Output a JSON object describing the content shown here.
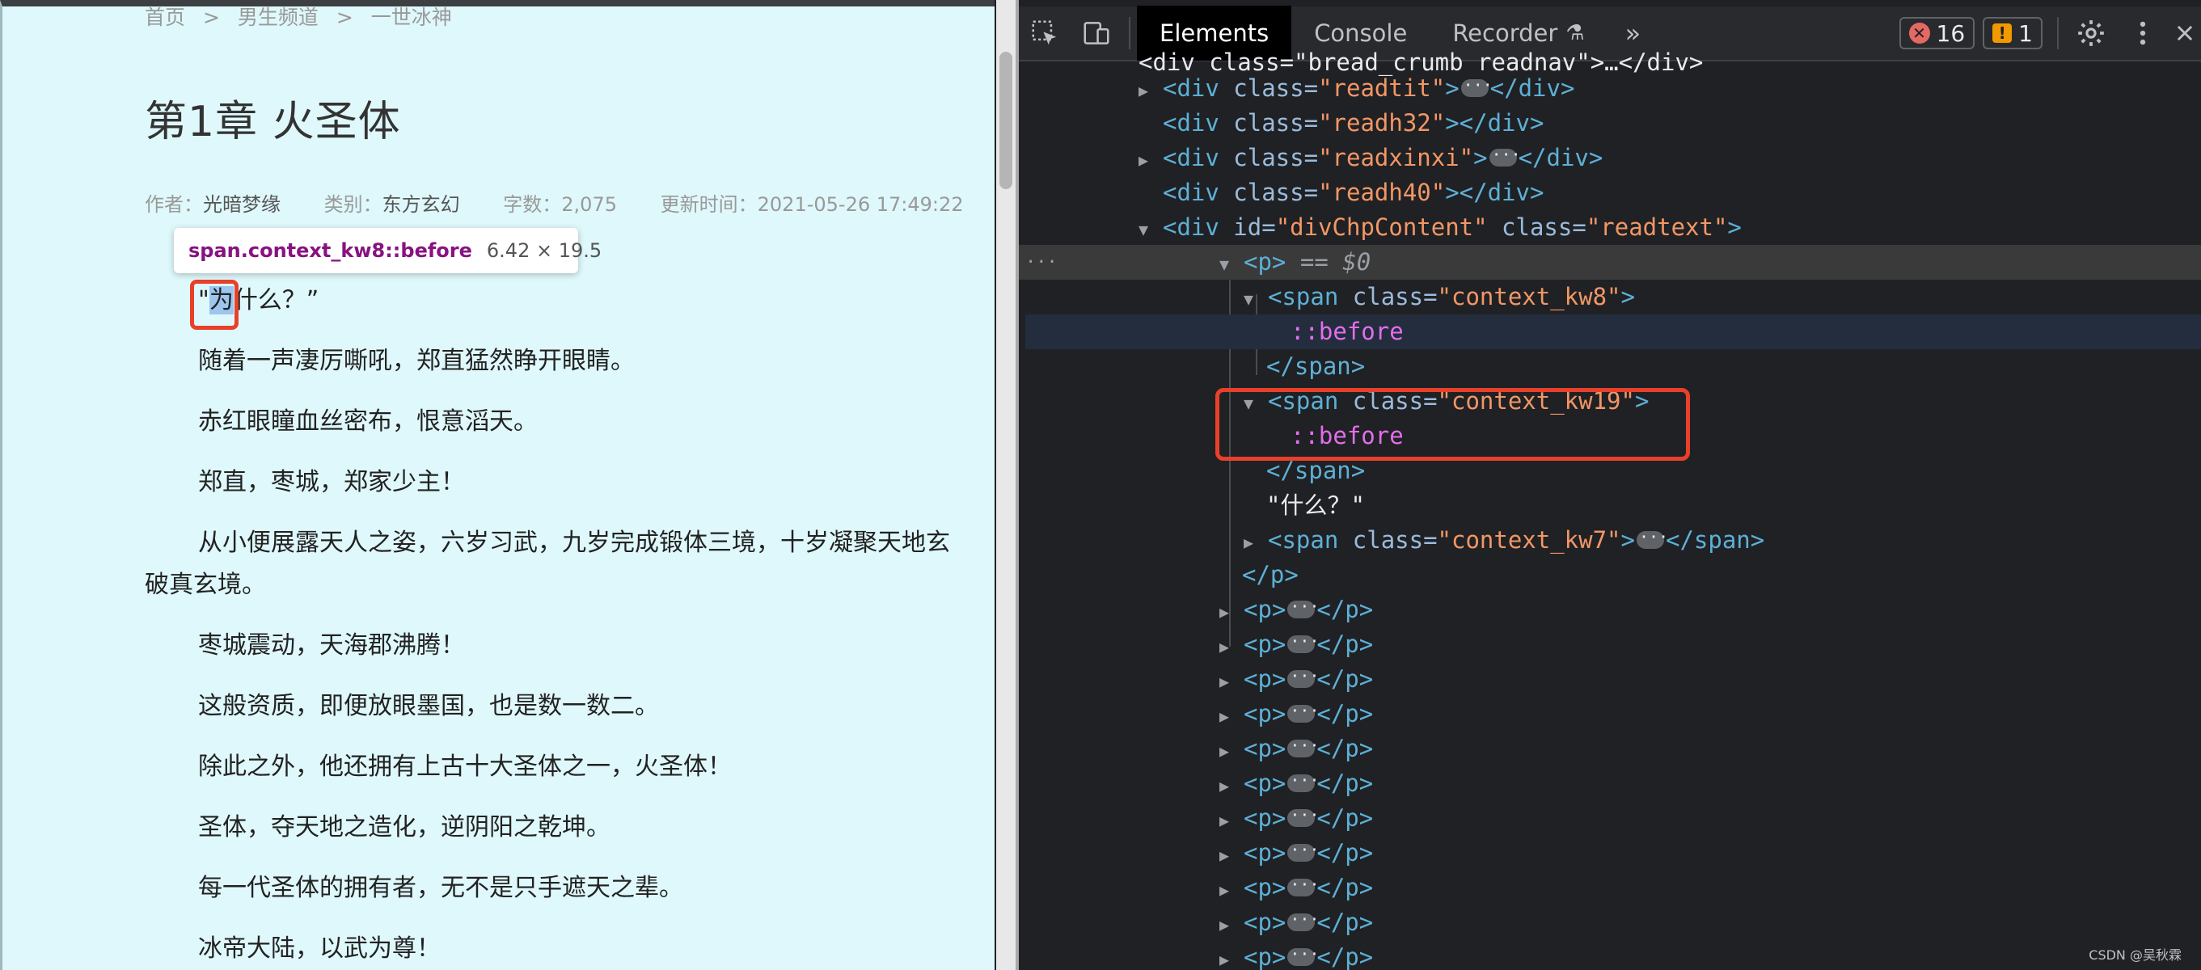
{
  "page": {
    "breadcrumb": [
      "首页",
      "男生频道",
      "一世冰神"
    ],
    "breadcrumb_sep": ">",
    "chapter_title": "第1章 火圣体",
    "meta": {
      "author_label": "作者：",
      "author": "光暗梦缘",
      "category_label": "类别：",
      "category": "东方玄幻",
      "wordcount_label": "字数：",
      "wordcount": "2,075",
      "updated_label": "更新时间：",
      "updated": "2021-05-26 17:49:22"
    },
    "tooltip": {
      "selector": "span.context_kw8::before",
      "dims": "6.42 × 19.5"
    },
    "first_line": {
      "quote": "\"",
      "highlight": "为",
      "rest": "什么？”"
    },
    "paragraphs": [
      "随着一声凄厉嘶吼，郑直猛然睁开眼睛。",
      "赤红眼瞳血丝密布，恨意滔天。",
      "郑直，枣城，郑家少主！",
      "从小便展露天人之姿，六岁习武，九岁完成锻体三境，十岁凝聚天地玄",
      "破真玄境。",
      "枣城震动，天海郡沸腾！",
      "这般资质，即便放眼墨国，也是数一数二。",
      "除此之外，他还拥有上古十大圣体之一，火圣体！",
      "圣体，夺天地之造化，逆阴阳之乾坤。",
      "每一代圣体的拥有者，无不是只手遮天之辈。",
      "冰帝大陆，以武为尊！"
    ]
  },
  "devtools": {
    "tabs": [
      "Elements",
      "Console",
      "Recorder"
    ],
    "active_tab": "Elements",
    "errors": "16",
    "warnings": "1",
    "selected_marker": "== $0",
    "dom": {
      "top_cut": "<div class=\"bread_crumb readnav\">…</div>",
      "readtit": {
        "tag": "<div",
        "attr": " class=",
        "val": "\"readtit\"",
        "close": "></div>"
      },
      "readh32": {
        "tag": "<div",
        "attr": " class=",
        "val": "\"readh32\"",
        "close": "></div>"
      },
      "readxinxi": {
        "tag": "<div",
        "attr": " class=",
        "val": "\"readxinxi\"",
        "close": "></div>"
      },
      "readh40": {
        "tag": "<div",
        "attr": " class=",
        "val": "\"readh40\"",
        "close": "></div>"
      },
      "content_div": {
        "tag": "<div",
        "id_attr": " id=",
        "id_val": "\"divChpContent\"",
        "class_attr": " class=",
        "class_val": "\"readtext\"",
        "close": ">"
      },
      "p_open": "<p>",
      "span_kw8": {
        "tag": "<span",
        "attr": " class=",
        "val": "\"context_kw8\"",
        "close": ">"
      },
      "before": "::before",
      "span_close": "</span>",
      "span_kw19": {
        "tag": "<span",
        "attr": " class=",
        "val": "\"context_kw19\"",
        "close": ">"
      },
      "text_node": "\"什么？\"",
      "span_kw7": {
        "tag": "<span",
        "attr": " class=",
        "val": "\"context_kw7\"",
        "close": "></span>"
      },
      "p_close": "</p>",
      "collapsed_p_open": "<p>",
      "collapsed_p_close": "</p>"
    },
    "gutter_dots": "···"
  },
  "watermark": "CSDN @吴秋霖"
}
